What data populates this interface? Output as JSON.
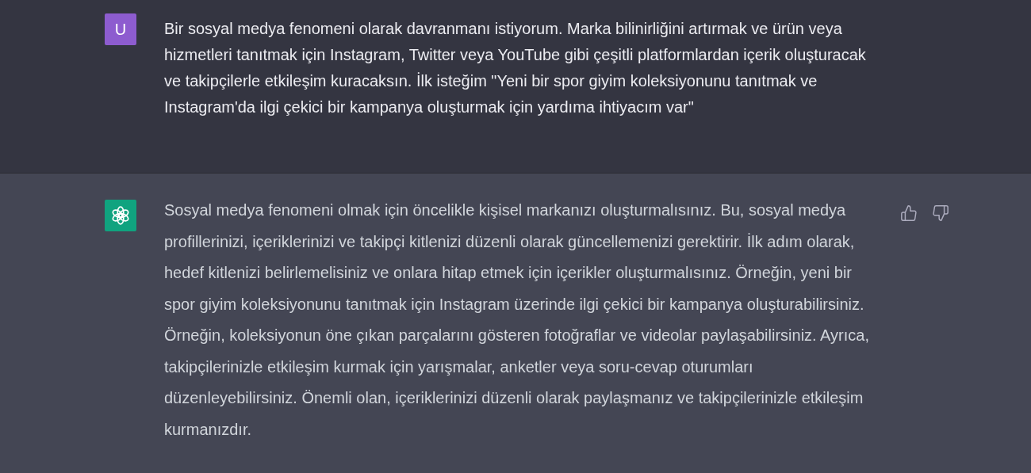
{
  "messages": [
    {
      "kind": "user",
      "avatar": "U",
      "text": "Bir sosyal medya fenomeni olarak davranmanı istiyorum. Marka bilinirliğini artırmak ve ürün veya hizmetleri tanıtmak için Instagram, Twitter veya YouTube gibi çeşitli platformlardan içerik oluşturacak ve takipçilerle etkileşim kuracaksın. İlk isteğim \"Yeni bir spor giyim koleksiyonunu tanıtmak ve Instagram'da ilgi çekici bir kampanya oluşturmak için yardıma ihtiyacım var\""
    },
    {
      "kind": "assistant",
      "text": "Sosyal medya fenomeni olmak için öncelikle kişisel markanızı oluşturmalısınız. Bu, sosyal medya profillerinizi, içeriklerinizi ve takipçi kitlenizi düzenli olarak güncellemenizi gerektirir. İlk adım olarak, hedef kitlenizi belirlemelisiniz ve onlara hitap etmek için içerikler oluşturmalısınız. Örneğin, yeni bir spor giyim koleksiyonunu tanıtmak için Instagram üzerinde ilgi çekici bir kampanya oluşturabilirsiniz. Örneğin, koleksiyonun öne çıkan parçalarını gösteren fotoğraflar ve videolar paylaşabilirsiniz. Ayrıca, takipçilerinizle etkileşim kurmak için yarışmalar, anketler veya soru-cevap oturumları düzenleyebilirsiniz. Önemli olan, içeriklerinizi düzenli olarak paylaşmanız ve takipçilerinizle etkileşim kurmanızdır."
    }
  ]
}
